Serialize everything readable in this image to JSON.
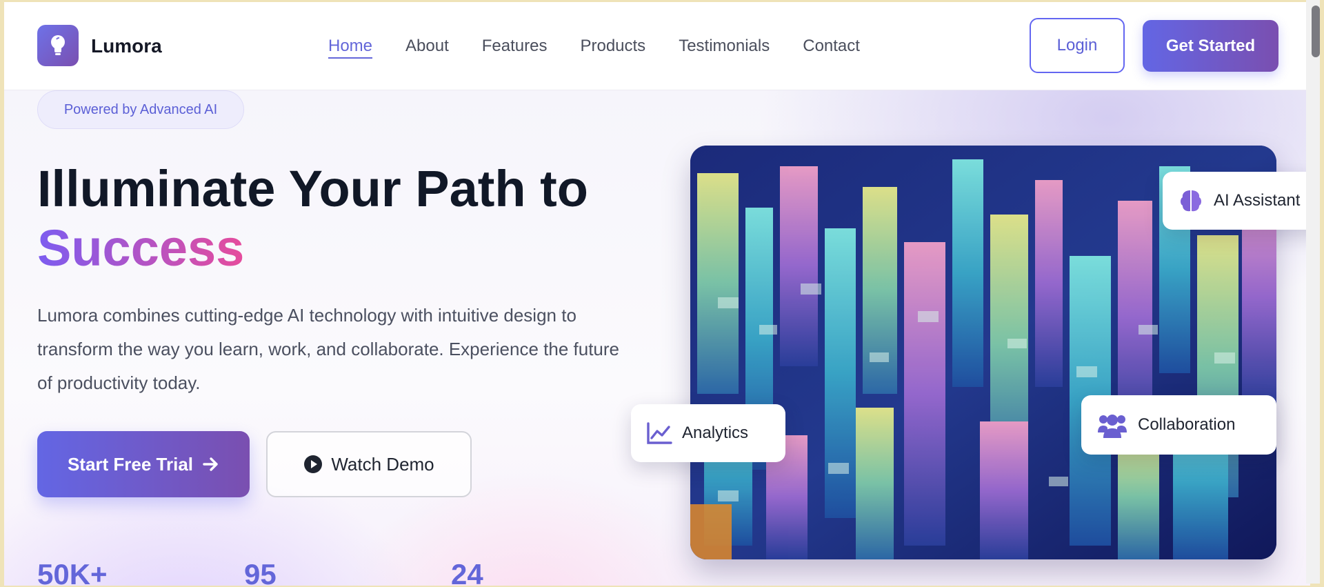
{
  "brand": {
    "name": "Lumora",
    "colors": {
      "primary": "#6366f1",
      "secondary": "#7a4fb0",
      "accent_pink": "#e64c9c"
    }
  },
  "nav": {
    "links": [
      {
        "label": "Home",
        "active": true
      },
      {
        "label": "About"
      },
      {
        "label": "Features"
      },
      {
        "label": "Products"
      },
      {
        "label": "Testimonials"
      },
      {
        "label": "Contact"
      }
    ],
    "login_label": "Login",
    "get_started_label": "Get Started"
  },
  "hero": {
    "badge": "Powered by Advanced AI",
    "title_line1": "Illuminate Your Path to",
    "title_accent": "Success",
    "description": "Lumora combines cutting-edge AI technology with intuitive design to transform the way you learn, work, and collaborate. Experience the future of productivity today.",
    "primary_cta": "Start Free Trial",
    "secondary_cta": "Watch Demo",
    "stats": [
      "50K+",
      "95",
      "24"
    ]
  },
  "floating_cards": {
    "ai_assistant": {
      "label": "AI Assistant",
      "icon": "brain-icon"
    },
    "analytics": {
      "label": "Analytics",
      "icon": "chart-line-icon"
    },
    "collaboration": {
      "label": "Collaboration",
      "icon": "users-icon"
    }
  }
}
